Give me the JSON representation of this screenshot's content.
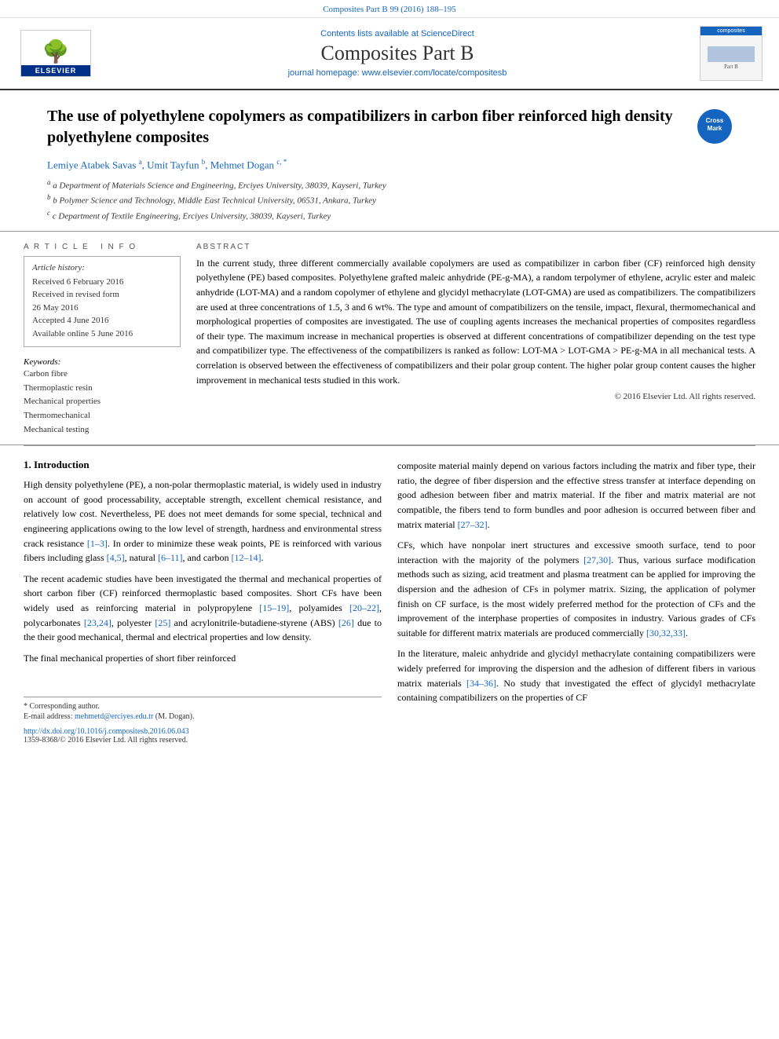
{
  "topbar": {
    "text": "Composites Part B 99 (2016) 188–195"
  },
  "header": {
    "sciencedirect": "Contents lists available at ScienceDirect",
    "journal_name": "Composites Part B",
    "homepage": "journal homepage: www.elsevier.com/locate/compositesb",
    "elsevier_label": "ELSEVIER",
    "composites_logo_top": "composites",
    "composites_logo_body": "Part B"
  },
  "article": {
    "title": "The use of polyethylene copolymers as compatibilizers in carbon fiber reinforced high density polyethylene composites",
    "authors": "Lemiye Atabek Savas a, Umit Tayfun b, Mehmet Dogan c, *",
    "affiliations": [
      "a Department of Materials Science and Engineering, Erciyes University, 38039, Kayseri, Turkey",
      "b Polymer Science and Technology, Middle East Technical University, 06531, Ankara, Turkey",
      "c Department of Textile Engineering, Erciyes University, 38039, Kayseri, Turkey"
    ],
    "article_info": {
      "label": "Article history:",
      "received": "Received 6 February 2016",
      "revised": "Received in revised form",
      "revised_date": "26 May 2016",
      "accepted": "Accepted 4 June 2016",
      "available": "Available online 5 June 2016"
    },
    "keywords_label": "Keywords:",
    "keywords": [
      "Carbon fibre",
      "Thermoplastic resin",
      "Mechanical properties",
      "Thermomechanical",
      "Mechanical testing"
    ],
    "abstract_heading": "ABSTRACT",
    "abstract_text": "In the current study, three different commercially available copolymers are used as compatibilizer in carbon fiber (CF) reinforced high density polyethylene (PE) based composites. Polyethylene grafted maleic anhydride (PE-g-MA), a random terpolymer of ethylene, acrylic ester and maleic anhydride (LOT-MA) and a random copolymer of ethylene and glycidyl methacrylate (LOT-GMA) are used as compatibilizers. The compatibilizers are used at three concentrations of 1.5, 3 and 6 wt%. The type and amount of compatibilizers on the tensile, impact, flexural, thermomechanical and morphological properties of composites are investigated. The use of coupling agents increases the mechanical properties of composites regardless of their type. The maximum increase in mechanical properties is observed at different concentrations of compatibilizer depending on the test type and compatibilizer type. The effectiveness of the compatibilizers is ranked as follow: LOT-MA > LOT-GMA > PE-g-MA in all mechanical tests. A correlation is observed between the effectiveness of compatibilizers and their polar group content. The higher polar group content causes the higher improvement in mechanical tests studied in this work.",
    "copyright": "© 2016 Elsevier Ltd. All rights reserved."
  },
  "body": {
    "section1_number": "1.",
    "section1_title": "Introduction",
    "para1": "High density polyethylene (PE), a non-polar thermoplastic material, is widely used in industry on account of good processability, acceptable strength, excellent chemical resistance, and relatively low cost. Nevertheless, PE does not meet demands for some special, technical and engineering applications owing to the low level of strength, hardness and environmental stress crack resistance [1–3]. In order to minimize these weak points, PE is reinforced with various fibers including glass [4,5], natural [6–11], and carbon [12–14].",
    "para2": "The recent academic studies have been investigated the thermal and mechanical properties of short carbon fiber (CF) reinforced thermoplastic based composites. Short CFs have been widely used as reinforcing material in polypropylene [15–19], polyamides [20–22], polycarbonates [23,24], polyester [25] and acrylonitrile-butadiene-styrene (ABS) [26] due to the their good mechanical, thermal and electrical properties and low density.",
    "para3": "The final mechanical properties of short fiber reinforced",
    "right_para1": "composite material mainly depend on various factors including the matrix and fiber type, their ratio, the degree of fiber dispersion and the effective stress transfer at interface depending on good adhesion between fiber and matrix material. If the fiber and matrix material are not compatible, the fibers tend to form bundles and poor adhesion is occurred between fiber and matrix material [27–32].",
    "right_para2": "CFs, which have nonpolar inert structures and excessive smooth surface, tend to poor interaction with the majority of the polymers [27,30]. Thus, various surface modification methods such as sizing, acid treatment and plasma treatment can be applied for improving the dispersion and the adhesion of CFs in polymer matrix. Sizing, the application of polymer finish on CF surface, is the most widely preferred method for the protection of CFs and the improvement of the interphase properties of composites in industry. Various grades of CFs suitable for different matrix materials are produced commercially [30,32,33].",
    "right_para3": "In the literature, maleic anhydride and glycidyl methacrylate containing compatibilizers were widely preferred for improving the dispersion and the adhesion of different fibers in various matrix materials [34–36]. No study that investigated the effect of glycidyl methacrylate containing compatibilizers on the properties of CF"
  },
  "footer": {
    "corresponding_note": "* Corresponding author.",
    "email_label": "E-mail address:",
    "email": "mehmetd@erciyes.edu.tr",
    "email_suffix": "(M. Dogan).",
    "doi": "http://dx.doi.org/10.1016/j.compositesb.2016.06.043",
    "issn": "1359-8368/© 2016 Elsevier Ltd. All rights reserved."
  }
}
